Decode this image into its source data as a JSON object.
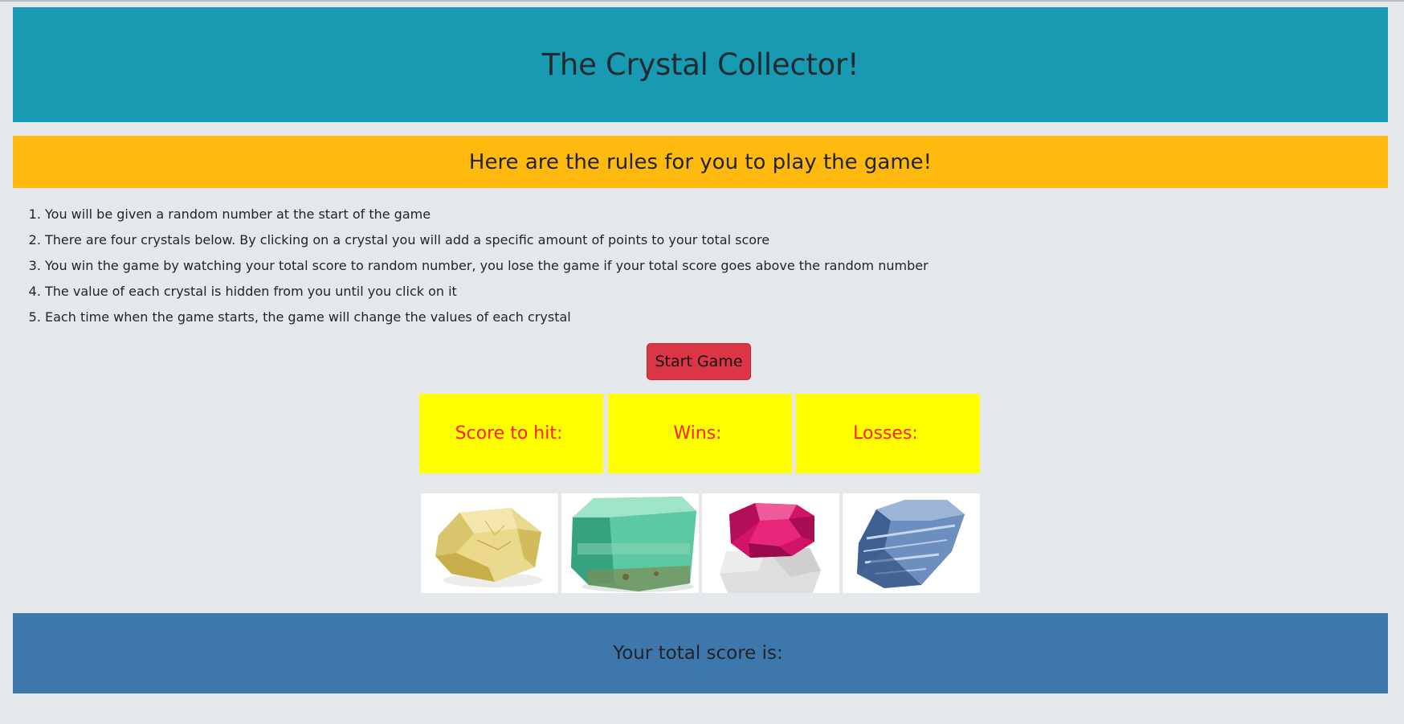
{
  "header": {
    "title": "The Crystal Collector!"
  },
  "rules": {
    "heading": "Here are the rules for you to play the game!",
    "items": [
      "You will be given a random number at the start of the game",
      "There are four crystals below. By clicking on a crystal you will add a specific amount of points to your total score",
      "You win the game by watching your total score to random number, you lose the game if your total score goes above the random number",
      "The value of each crystal is hidden from you until you click on it",
      "Each time when the game starts, the game will change the values of each crystal"
    ]
  },
  "controls": {
    "start_label": "Start Game"
  },
  "stats": {
    "score_to_hit_label": "Score to hit:",
    "score_to_hit_value": "",
    "wins_label": "Wins:",
    "wins_value": "",
    "losses_label": "Losses:",
    "losses_value": ""
  },
  "crystals": [
    {
      "name": "yellow-crystal",
      "color": "#e6d27a"
    },
    {
      "name": "green-crystal",
      "color": "#3fb08e"
    },
    {
      "name": "pink-crystal",
      "color": "#d8156b"
    },
    {
      "name": "blue-crystal",
      "color": "#4a6c9e"
    }
  ],
  "footer": {
    "total_label": "Your total score is:",
    "total_value": ""
  },
  "colors": {
    "header_bg": "#189ab3",
    "rules_banner_bg": "#ffb90f",
    "start_button_bg": "#dc3545",
    "stat_box_bg": "#ffff00",
    "stat_text": "#ff1f1f",
    "footer_bg": "#3e77ab",
    "page_bg": "#e5e8eb"
  }
}
